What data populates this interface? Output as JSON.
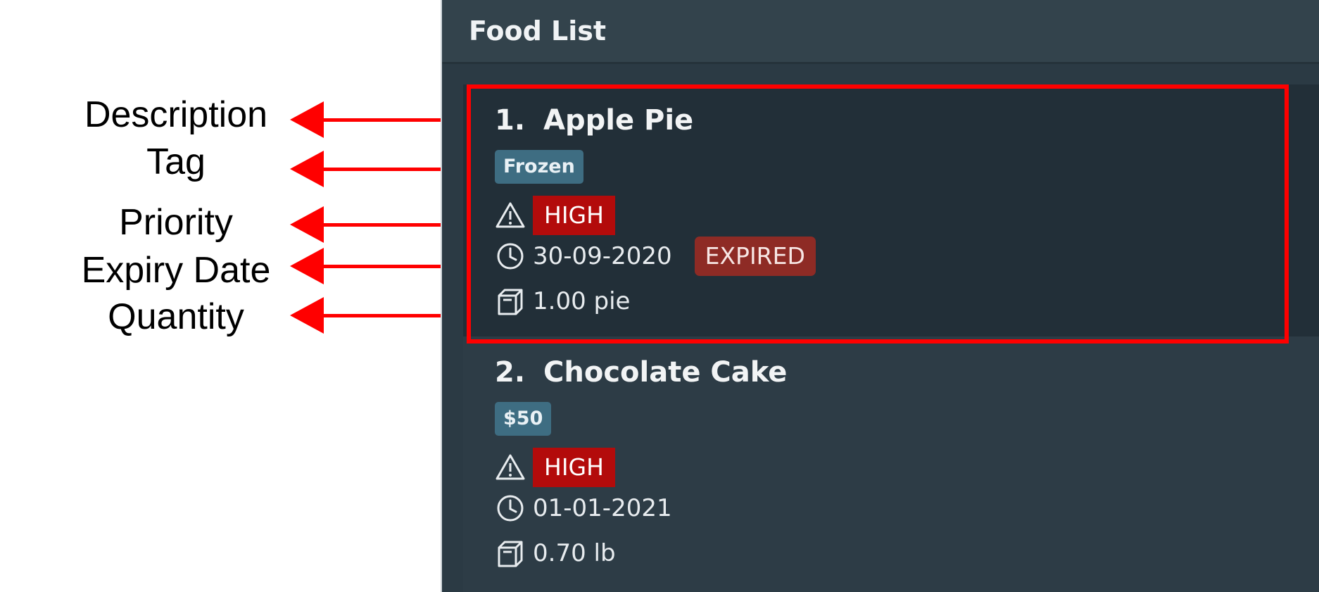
{
  "annotations": [
    {
      "label": "Description"
    },
    {
      "label": "Tag"
    },
    {
      "label": "Priority"
    },
    {
      "label": "Expiry Date"
    },
    {
      "label": "Quantity"
    }
  ],
  "panel": {
    "title": "Food List"
  },
  "foods": [
    {
      "index": "1.",
      "name": "Apple Pie",
      "tag": "Frozen",
      "priority": "HIGH",
      "expiry": "30-09-2020",
      "status": "EXPIRED",
      "quantity": "1.00 pie"
    },
    {
      "index": "2.",
      "name": "Chocolate Cake",
      "tag": "$50",
      "priority": "HIGH",
      "expiry": "01-01-2021",
      "status": "",
      "quantity": "0.70 lb"
    }
  ],
  "colors": {
    "annotation_arrow": "#ff0000",
    "priority_high": "#b30b0b",
    "expired_badge": "#8e2b25",
    "tag": "#3e6d82",
    "panel_bg": "#2b3a44"
  },
  "icons": [
    "warning-icon",
    "clock-icon",
    "box-icon"
  ]
}
